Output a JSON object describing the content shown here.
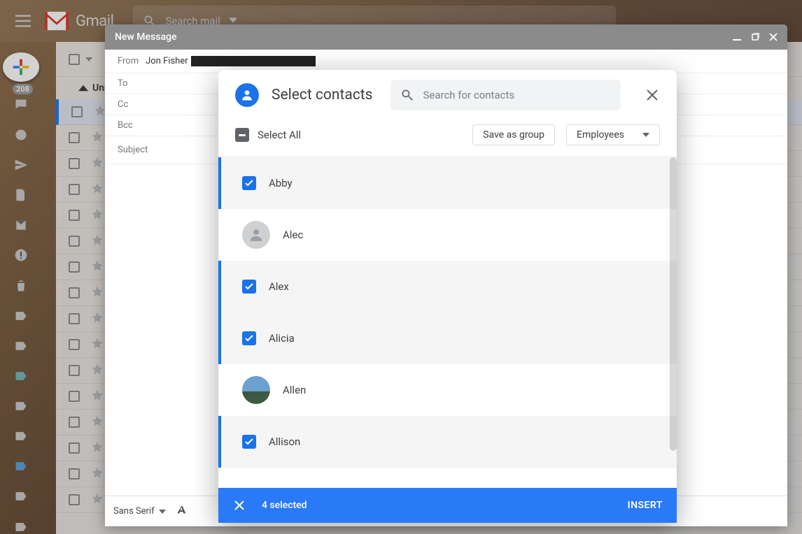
{
  "app": {
    "title": "Gmail",
    "search_placeholder": "Search mail"
  },
  "sidebar": {
    "unread_label": "Unre",
    "badge": "208"
  },
  "compose": {
    "title": "New Message",
    "from_label": "From",
    "from_name": "Jon Fisher",
    "to_label": "To",
    "cc_label": "Cc",
    "bcc_label": "Bcc",
    "subject_label": "Subject",
    "font": "Sans Serif"
  },
  "dialog": {
    "title": "Select contacts",
    "search_placeholder": "Search for contacts",
    "select_all": "Select All",
    "save_group": "Save as group",
    "group_selected": "Employees",
    "contacts": [
      {
        "name": "Abby",
        "selected": true
      },
      {
        "name": "Alec",
        "selected": false
      },
      {
        "name": "Alex",
        "selected": true
      },
      {
        "name": "Alicia",
        "selected": true
      },
      {
        "name": "Allen",
        "selected": false,
        "has_photo": true
      },
      {
        "name": "Allison",
        "selected": true
      }
    ],
    "selected_count": "4 selected",
    "insert_label": "INSERT"
  }
}
